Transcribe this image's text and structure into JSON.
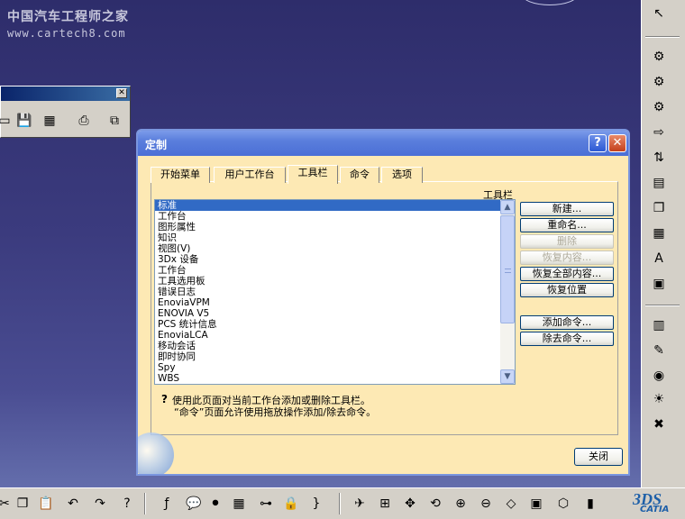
{
  "watermark": {
    "title": "中国汽车工程师之家",
    "url": "www.cartech8.com"
  },
  "dialog": {
    "title": "定制",
    "help_glyph": "?",
    "close_glyph": "✕",
    "tabs": [
      "开始菜单",
      "用户工作台",
      "工具栏",
      "命令",
      "选项"
    ],
    "active_tab": "工具栏",
    "group_label": "工具栏",
    "toolbar_list": [
      "标准",
      "工作台",
      "图形属性",
      "知识",
      "视图(V)",
      "3Dx 设备",
      "工作台",
      "工具选用板",
      "错误日志",
      "EnoviaVPM",
      "ENOVIA V5",
      "PCS 统计信息",
      "EnoviaLCA",
      "移动会话",
      "即时协同",
      "Spy",
      "WBS"
    ],
    "selected_item": "标准",
    "buttons": {
      "new": "新建...",
      "rename": "重命名...",
      "delete": "删除",
      "restore_contents": "恢复内容...",
      "restore_all_contents": "恢复全部内容...",
      "restore_position": "恢复位置",
      "add_commands": "添加命令...",
      "remove_commands": "除去命令..."
    },
    "hint_line1": "使用此页面对当前工作台添加或删除工具栏。",
    "hint_line2": "“命令”页面允许使用拖放操作添加/除去命令。",
    "close_button": "关闭"
  },
  "floating_toolbar": {
    "close_glyph": "✕"
  },
  "catia_logo": {
    "mark": "3DS",
    "name": "CATIA"
  },
  "icons": {
    "right_toolbar": [
      "select-arrow-icon",
      "gear-icon",
      "gear-icon",
      "gear-icon",
      "export-icon",
      "filter-icon",
      "book-icon",
      "copy-icon",
      "sheet-icon",
      "text-icon",
      "package-icon",
      "chart-icon",
      "ruler-icon",
      "eye-icon",
      "lightbulb-icon",
      "hide-icon"
    ],
    "bottom_toolbar": [
      "cut-icon",
      "copy-icon",
      "paste-icon",
      "undo-icon",
      "redo-icon",
      "whats-this-icon",
      "formula-icon",
      "comment-icon",
      "traffic-light-icon",
      "table-icon",
      "tree-icon",
      "lock-icon",
      "bracket-icon",
      "fly-icon",
      "fit-all-icon",
      "pan-icon",
      "rotate-icon",
      "zoom-in-icon",
      "zoom-out-icon",
      "normal-view-icon",
      "multi-view-icon",
      "iso-view-icon",
      "shading-icon"
    ]
  }
}
